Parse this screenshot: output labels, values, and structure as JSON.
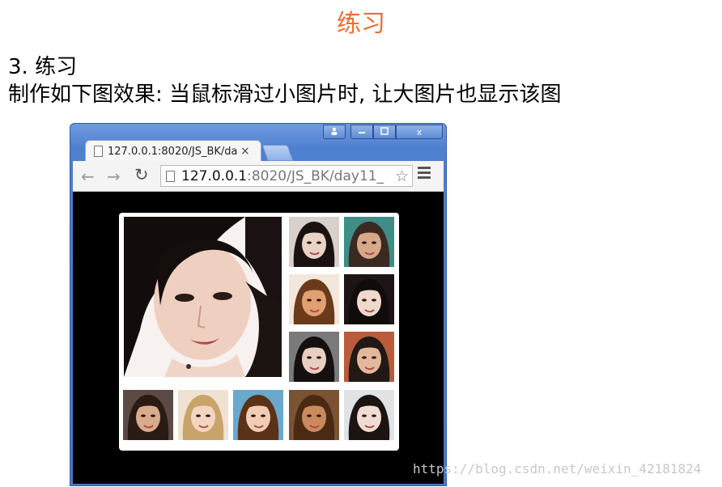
{
  "slide": {
    "title": "练习",
    "subtitle": "3. 练习",
    "description": "制作如下图效果: 当鼠标滑过小图片时, 让大图片也显示该图"
  },
  "browser": {
    "tab_title": "127.0.0.1:8020/JS_BK/da",
    "tab_close": "×",
    "url_host": "127.0.0.1",
    "url_path": ":8020/JS_BK/day11_",
    "win_buttons": {
      "user": "👤",
      "minimize": "▭",
      "maximize": "▣",
      "close": "x"
    }
  },
  "gallery": {
    "main_photo": "portrait-large",
    "thumbnails": [
      {
        "id": "thumb-1",
        "tone": "#e9d3c6",
        "hair": "#1a1210"
      },
      {
        "id": "thumb-2",
        "tone": "#d8a88a",
        "hair": "#3a2a22"
      },
      {
        "id": "thumb-3",
        "tone": "#e0a070",
        "hair": "#6a3a1a"
      },
      {
        "id": "thumb-4",
        "tone": "#f0d8cc",
        "hair": "#100c0a"
      },
      {
        "id": "thumb-5",
        "tone": "#e8cfc2",
        "hair": "#151010"
      },
      {
        "id": "thumb-6",
        "tone": "#e4b89c",
        "hair": "#221814"
      },
      {
        "id": "thumb-7",
        "tone": "#d9aa8c",
        "hair": "#2a1a14"
      },
      {
        "id": "thumb-8",
        "tone": "#f2d6bf",
        "hair": "#c9a46a"
      },
      {
        "id": "thumb-9",
        "tone": "#f1cdb6",
        "hair": "#5a3218"
      },
      {
        "id": "thumb-10",
        "tone": "#c98a5e",
        "hair": "#4a2a14"
      },
      {
        "id": "thumb-11",
        "tone": "#f0dcd2",
        "hair": "#1b1412"
      }
    ]
  },
  "watermark": "https://blog.csdn.net/weixin_42181824"
}
